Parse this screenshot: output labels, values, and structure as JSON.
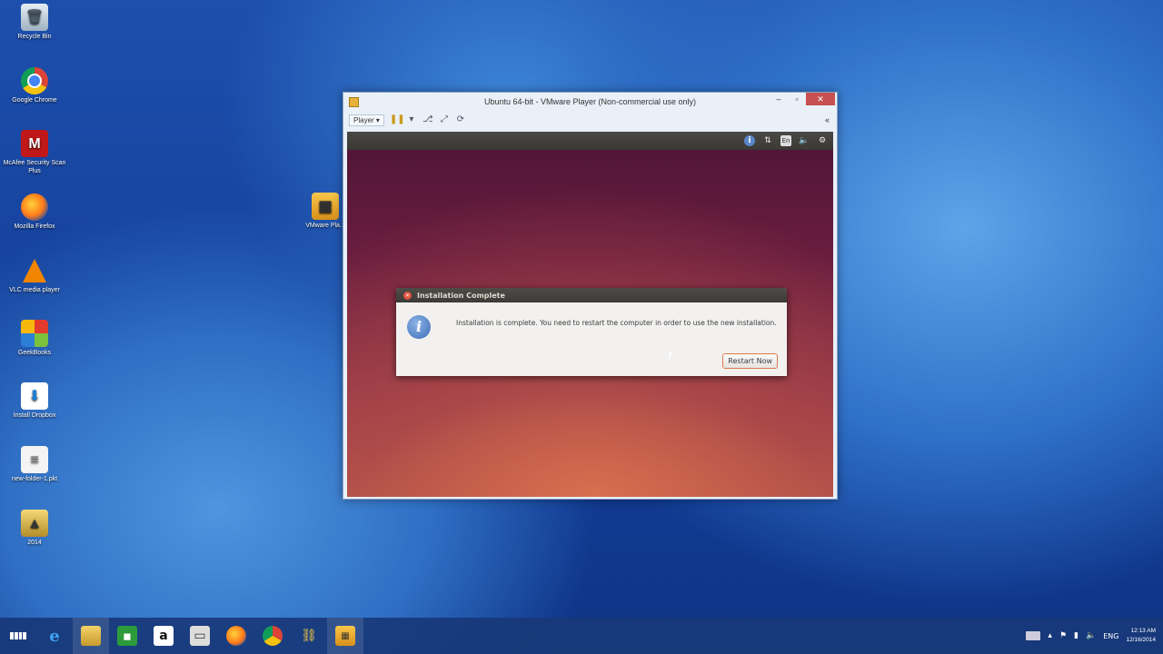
{
  "desktop": {
    "icons": [
      {
        "label": "Recycle Bin",
        "icon": "recycle-bin-icon",
        "glyph": "🗑"
      },
      {
        "label": "Google Chrome",
        "icon": "chrome-icon",
        "glyph": ""
      },
      {
        "label": "McAfee Security Scan Plus",
        "icon": "mcafee-icon",
        "glyph": "M"
      },
      {
        "label": "Mozilla Firefox",
        "icon": "firefox-icon",
        "glyph": ""
      },
      {
        "label": "VLC media player",
        "icon": "vlc-icon",
        "glyph": ""
      },
      {
        "label": "GeekBooks",
        "icon": "app-tiles-icon",
        "glyph": ""
      },
      {
        "label": "Install Dropbox",
        "icon": "dropbox-icon",
        "glyph": "⬇"
      },
      {
        "label": "new-folder-1.pkt",
        "icon": "document-icon",
        "glyph": "≡"
      },
      {
        "label": "2014",
        "icon": "file-icon",
        "glyph": "▲"
      },
      {
        "label": "VMware Pla...",
        "icon": "vmware-icon",
        "glyph": "▦"
      }
    ]
  },
  "vm_window": {
    "title": "Ubuntu 64-bit - VMware Player (Non-commercial use only)",
    "controls": {
      "minimize": "–",
      "maximize": "▫",
      "close": "✕"
    },
    "toolbar": {
      "player_menu": "Player ▾",
      "collapse": "«"
    }
  },
  "ubuntu_panel": {
    "lang": "En"
  },
  "dialog": {
    "title": "Installation Complete",
    "message": "Installation is complete. You need to restart the computer in order to use the new installation.",
    "button": "Restart Now"
  },
  "taskbar": {
    "clock_time": "12:13 AM",
    "clock_date": "12/16/2014",
    "lang": "ENG"
  }
}
